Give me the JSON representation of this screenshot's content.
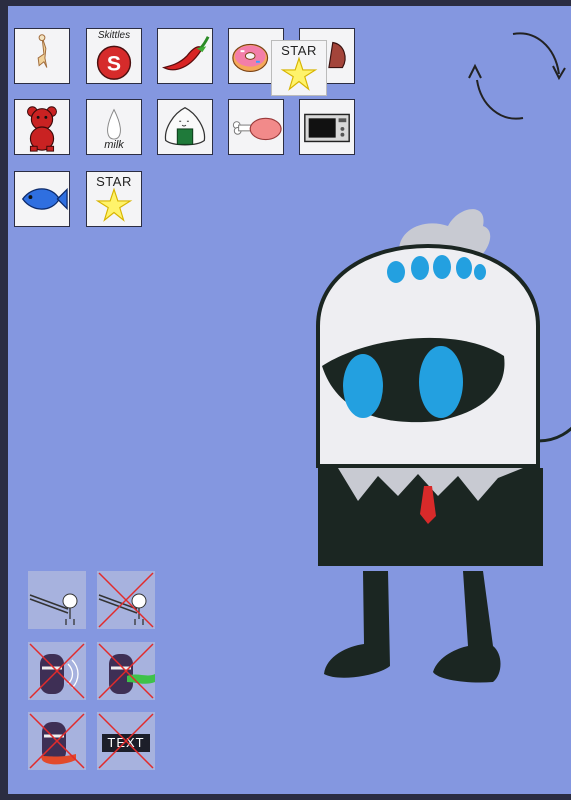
{
  "inventory": {
    "items": [
      {
        "name": "chicken-bone",
        "label": ""
      },
      {
        "name": "skittles",
        "label": "Skittles"
      },
      {
        "name": "chili-pepper",
        "label": ""
      },
      {
        "name": "donut",
        "label": ""
      },
      {
        "name": "partial-item",
        "label": ""
      },
      {
        "name": "red-teddy-bear",
        "label": ""
      },
      {
        "name": "milk",
        "label": "milk"
      },
      {
        "name": "onigiri",
        "label": ""
      },
      {
        "name": "drumstick",
        "label": ""
      },
      {
        "name": "microwave",
        "label": ""
      },
      {
        "name": "fish",
        "label": ""
      },
      {
        "name": "star",
        "label": "STAR"
      }
    ],
    "dragging": {
      "name": "star",
      "label": "STAR"
    }
  },
  "actions": {
    "items": [
      {
        "name": "action-sweep",
        "disabled": false
      },
      {
        "name": "action-sweep-alt",
        "disabled": true
      },
      {
        "name": "action-shout",
        "disabled": true
      },
      {
        "name": "action-green-breath",
        "disabled": true
      },
      {
        "name": "action-red-tongue",
        "disabled": true
      },
      {
        "name": "action-text",
        "disabled": true,
        "label": "TEXT"
      }
    ]
  },
  "colors": {
    "background": "#8497e0",
    "frame": "#2b2d42",
    "tile": "#f4f4f6",
    "action_tile": "#a7b2de",
    "character_body": "#eeeef2",
    "character_dark": "#1b2622",
    "eye_blue": "#23a0e0",
    "hair_gray": "#c8cad2",
    "cross_red": "#e22b2b"
  },
  "icons": {
    "reset": "rotate-arrows-icon"
  }
}
